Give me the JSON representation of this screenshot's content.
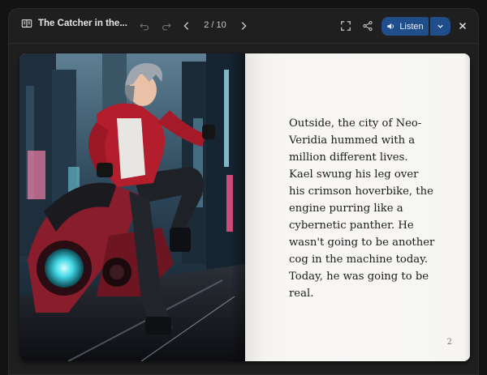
{
  "toolbar": {
    "book_icon": "book-icon",
    "title": "The Catcher in the...",
    "page_indicator": "2 / 10",
    "listen_label": "Listen",
    "icons": {
      "undo": "undo-icon",
      "redo": "redo-icon",
      "prev": "chevron-left-icon",
      "next": "chevron-right-icon",
      "fullscreen": "fullscreen-icon",
      "share": "share-icon",
      "speaker": "speaker-icon",
      "dropdown": "chevron-down-icon",
      "close": "close-icon"
    },
    "colors": {
      "listen_bg": "#1f4e8a",
      "toolbar_bg": "#1f1f20"
    }
  },
  "book": {
    "illustration": "anime-style boy in red jacket riding red hoverbike through neon city",
    "story_text": "Outside, the city of Neo-Veridia hummed with a million different lives. Kael swung his leg over his crimson hoverbike, the engine purring like a cybernetic panther. He wasn't going to be another cog in the machine today. Today, he was going to be real.",
    "page_number": "2"
  }
}
